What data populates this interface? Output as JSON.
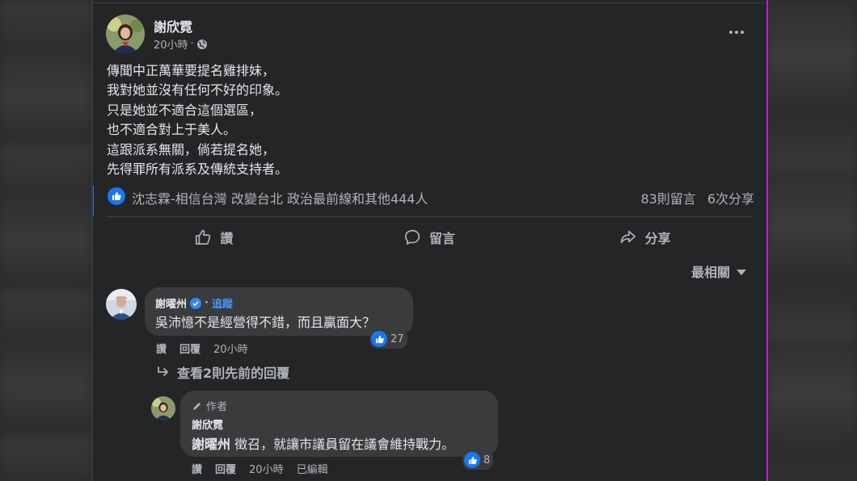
{
  "post": {
    "author": "謝欣霓",
    "time": "20小時",
    "dot": "·",
    "body": [
      "傳聞中正萬華要提名雞排妹，",
      "我對她並沒有任何不好的印象。",
      "只是她並不適合這個選區，",
      "也不適合對上于美人。",
      "這跟派系無關，倘若提名她，",
      "先得罪所有派系及傳統支持者。"
    ]
  },
  "reactions": {
    "names": "沈志霖-相信台灣 改變台北 政治最前線和其他444人",
    "comments": "83則留言",
    "shares": "6次分享"
  },
  "actions": {
    "like": "讚",
    "comment": "留言",
    "share": "分享"
  },
  "sort": {
    "label": "最相關"
  },
  "comment1": {
    "author": "謝曜州",
    "follow": "追蹤",
    "text": "吳沛憶不是經營得不錯，而且贏面大？",
    "likes": "27",
    "like_label": "讚",
    "reply_label": "回覆",
    "time": "20小時"
  },
  "view_replies": "查看2則先前的回覆",
  "comment2": {
    "badge": "作者",
    "author": "謝欣霓",
    "mention": "謝曜州",
    "text": " 徵召，就讓市議員留在議會維持戰力。",
    "likes": "8",
    "like_label": "讚",
    "reply_label": "回覆",
    "time": "20小時",
    "edited": "已編輯"
  },
  "colors": {
    "accent": "#1877f2",
    "link": "#4599ff",
    "frame_right": "#c21bd1"
  }
}
